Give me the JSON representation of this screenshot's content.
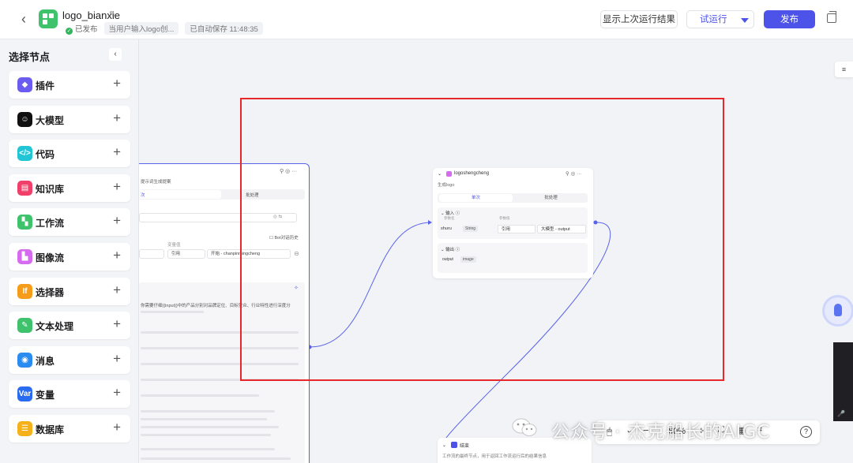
{
  "header": {
    "app_title": "logo_bianxie",
    "published": "已发布",
    "desc": "当用户输入logo创...",
    "autosave": "已自动保存 11:48:35",
    "show_last_label": "显示上次运行结果",
    "try_run_label": "试运行",
    "publish_label": "发布"
  },
  "sidebar": {
    "title": "选择节点",
    "items": [
      {
        "label": "插件",
        "color": "#6b5cf0"
      },
      {
        "label": "大模型",
        "color": "#111111"
      },
      {
        "label": "代码",
        "color": "#22c5d6"
      },
      {
        "label": "知识库",
        "color": "#f0406a"
      },
      {
        "label": "工作流",
        "color": "#3ec26b"
      },
      {
        "label": "图像流",
        "color": "#d66bf0"
      },
      {
        "label": "选择器",
        "color": "#f59c1a"
      },
      {
        "label": "文本处理",
        "color": "#3ec26b"
      },
      {
        "label": "消息",
        "color": "#2a8cf0"
      },
      {
        "label": "变量",
        "color": "#2a6cf0"
      },
      {
        "label": "数据库",
        "color": "#f5b01a"
      }
    ],
    "icon_glyphs": [
      "◆",
      "☺",
      "</>",
      "▤",
      "▚",
      "▙",
      "If",
      "✎",
      "◉",
      "Var",
      "☰"
    ]
  },
  "node_left": {
    "subtitle": "提示词生成提案",
    "tab_on": "次",
    "tab_off": "批处理",
    "ref_label": "变量值",
    "ref_type": "引用",
    "ref_value": "开始 - chanpinmingcheng",
    "chat_history": "Bot对话历史",
    "prompt_line": "你需要仔细{{input}}中的产品分别对品牌定位、目标受众、行业特性进行深度分"
  },
  "node_right": {
    "title": "logoshengcheng",
    "desc": "生成logo",
    "tab_single": "单次",
    "tab_batch": "批处理",
    "input_label": "输入",
    "param_name_header": "参数名",
    "param_value_header": "参数值",
    "input_name": "shuru",
    "input_type": "String",
    "ref_type": "引用",
    "ref_value": "大模型 - output",
    "output_label": "输出",
    "output_name": "output",
    "output_type": "image"
  },
  "node_end": {
    "title": "结束",
    "desc": "工作流的最终节点，用于返回工作流运行后的结果信息"
  },
  "controls": {
    "zoom": "60%",
    "help": "?"
  },
  "watermark": "公众号 · 杰克船长的AIGC"
}
